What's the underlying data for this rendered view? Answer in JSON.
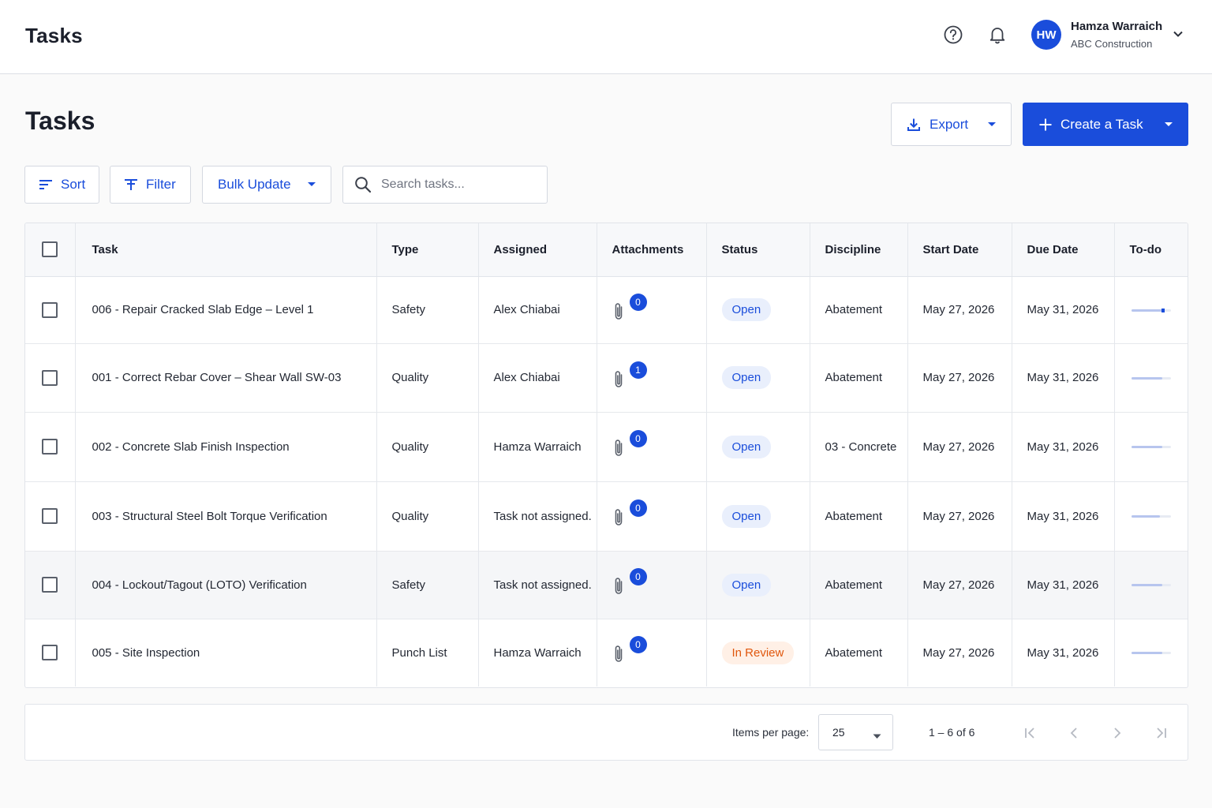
{
  "app": {
    "title": "Tasks",
    "user": {
      "initials": "HW",
      "name": "Hamza Warraich",
      "org": "ABC Construction"
    },
    "accent": "#1a4ddb"
  },
  "header": {
    "title": "Tasks",
    "export_label": "Export",
    "create_label": "Create a Task"
  },
  "toolbar": {
    "sort_label": "Sort",
    "filter_label": "Filter",
    "bulk_label": "Bulk Update",
    "search_placeholder": "Search tasks..."
  },
  "table": {
    "columns": [
      "Task",
      "Type",
      "Assigned",
      "Attachments",
      "Status",
      "Discipline",
      "Start Date",
      "Due Date",
      "To-do"
    ],
    "rows": [
      {
        "task": "006 - Repair Cracked Slab Edge – Level 1",
        "type": "Safety",
        "assigned": "Alex Chiabai",
        "attachments": "0",
        "status": "Open",
        "status_kind": "open",
        "discipline": "Abatement",
        "start": "May 27, 2026",
        "due": "May 31, 2026",
        "todo_progress": 0.8
      },
      {
        "task": "001 - Correct Rebar Cover – Shear Wall SW-03",
        "type": "Quality",
        "assigned": "Alex Chiabai",
        "attachments": "1",
        "status": "Open",
        "status_kind": "open",
        "discipline": "Abatement",
        "start": "May 27, 2026",
        "due": "May 31, 2026",
        "todo_progress": 0.78
      },
      {
        "task": "002 - Concrete Slab Finish Inspection",
        "type": "Quality",
        "assigned": "Hamza Warraich",
        "attachments": "0",
        "status": "Open",
        "status_kind": "open",
        "discipline": "03 - Concrete",
        "start": "May 27, 2026",
        "due": "May 31, 2026",
        "todo_progress": 0.78
      },
      {
        "task": "003 - Structural Steel Bolt Torque Verification",
        "type": "Quality",
        "assigned": "Task not assigned.",
        "attachments": "0",
        "status": "Open",
        "status_kind": "open",
        "discipline": "Abatement",
        "start": "May 27, 2026",
        "due": "May 31, 2026",
        "todo_progress": 0.72
      },
      {
        "task": "004 - Lockout/Tagout (LOTO) Verification",
        "type": "Safety",
        "assigned": "Task not assigned.",
        "attachments": "0",
        "status": "Open",
        "status_kind": "open",
        "discipline": "Abatement",
        "start": "May 27, 2026",
        "due": "May 31, 2026",
        "todo_progress": 0.78
      },
      {
        "task": "005 - Site Inspection",
        "type": "Punch List",
        "assigned": "Hamza Warraich",
        "attachments": "0",
        "status": "In Review",
        "status_kind": "review",
        "discipline": "Abatement",
        "start": "May 27, 2026",
        "due": "May 31, 2026",
        "todo_progress": 0.78
      }
    ]
  },
  "pagination": {
    "items_per_page_label": "Items per page:",
    "items_per_page": "25",
    "range": "1 – 6 of 6"
  }
}
